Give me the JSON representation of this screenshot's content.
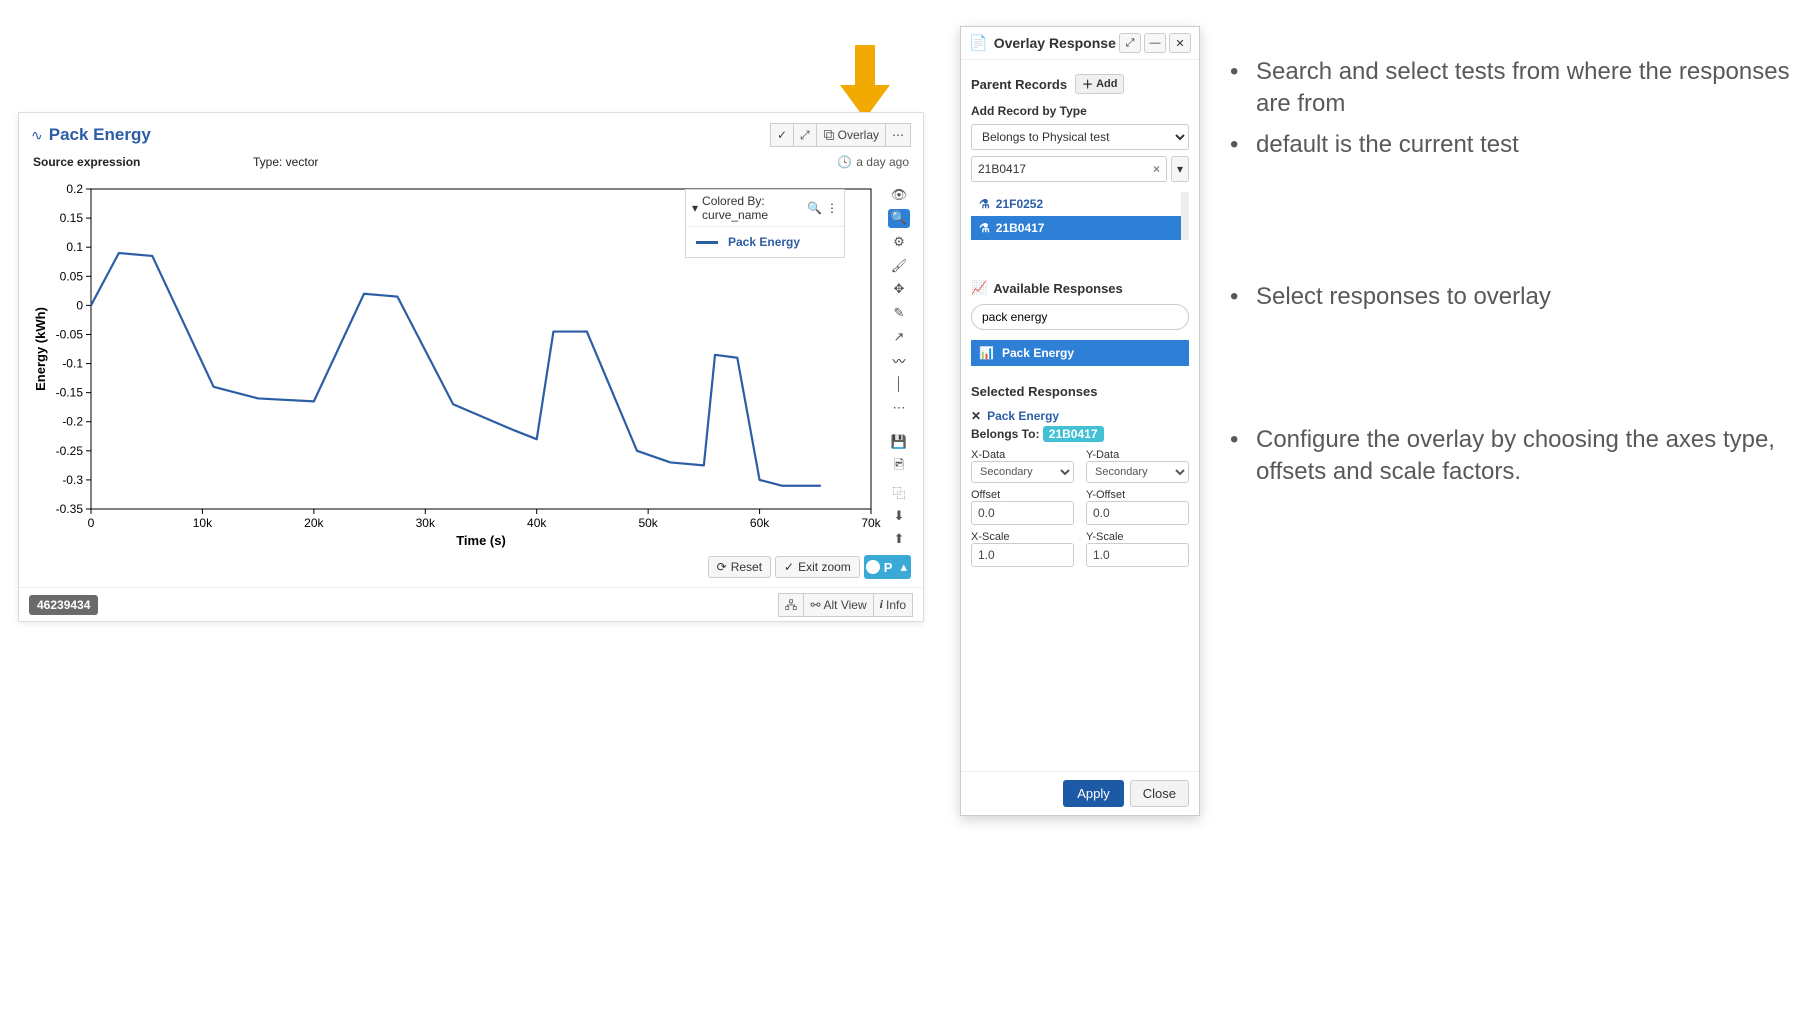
{
  "chart_panel": {
    "title": "Pack Energy",
    "source_label": "Source expression",
    "type_label": "Type: vector",
    "age_label": "a day ago",
    "overlay_btn": "Overlay",
    "reset_btn": "Reset",
    "exit_zoom_btn": "Exit zoom",
    "p_toggle": "P",
    "alt_view_btn": "Alt View",
    "info_btn": "Info",
    "id_badge": "46239434",
    "legend_head": "Colored By: curve_name",
    "legend_item": "Pack Energy"
  },
  "chart_data": {
    "type": "line",
    "title": "Pack Energy",
    "xlabel": "Time (s)",
    "ylabel": "Energy (kWh)",
    "xlim": [
      0,
      70000
    ],
    "ylim": [
      -0.35,
      0.2
    ],
    "xticks": [
      0,
      10000,
      20000,
      30000,
      40000,
      50000,
      60000,
      70000
    ],
    "xtick_labels": [
      "0",
      "10k",
      "20k",
      "30k",
      "40k",
      "50k",
      "60k",
      "70k"
    ],
    "yticks": [
      -0.35,
      -0.3,
      -0.25,
      -0.2,
      -0.15,
      -0.1,
      -0.05,
      0,
      0.05,
      0.1,
      0.15,
      0.2
    ],
    "series": [
      {
        "name": "Pack Energy",
        "color": "#2c5ea6",
        "x": [
          0,
          2500,
          5500,
          11000,
          15000,
          20000,
          24500,
          27500,
          32500,
          38000,
          40000,
          41500,
          44500,
          49000,
          52000,
          55000,
          56000,
          58000,
          60000,
          62000,
          65500
        ],
        "y": [
          0.0,
          0.09,
          0.085,
          -0.14,
          -0.16,
          -0.165,
          0.02,
          0.015,
          -0.17,
          -0.215,
          -0.23,
          -0.045,
          -0.045,
          -0.25,
          -0.27,
          -0.275,
          -0.085,
          -0.09,
          -0.3,
          -0.31,
          -0.31
        ]
      }
    ]
  },
  "overlay": {
    "title": "Overlay Response",
    "parent_records": "Parent Records",
    "add_btn": "Add",
    "add_by_type": "Add Record by Type",
    "type_select": "Belongs to Physical test",
    "search_value": "21B0417",
    "records": [
      "21F0252",
      "21B0417"
    ],
    "records_selected_index": 1,
    "avail_head": "Available Responses",
    "avail_search": "pack energy",
    "avail_item": "Pack Energy",
    "sel_head": "Selected Responses",
    "sel_item": "Pack Energy",
    "belongs_label": "Belongs To:",
    "belongs_value": "21B0417",
    "xdata": "X-Data",
    "ydata": "Y-Data",
    "xdata_val": "Secondary",
    "ydata_val": "Secondary",
    "offset": "Offset",
    "yoffset": "Y-Offset",
    "offset_val": "0.0",
    "yoffset_val": "0.0",
    "xscale": "X-Scale",
    "yscale": "Y-Scale",
    "xscale_val": "1.0",
    "yscale_val": "1.0",
    "apply": "Apply",
    "close": "Close"
  },
  "notes": {
    "b1": [
      "Search and select tests from where the responses are from",
      "default is the current test"
    ],
    "b2": [
      "Select responses to overlay"
    ],
    "b3": [
      "Configure the overlay by choosing the axes type, offsets and scale factors."
    ]
  }
}
